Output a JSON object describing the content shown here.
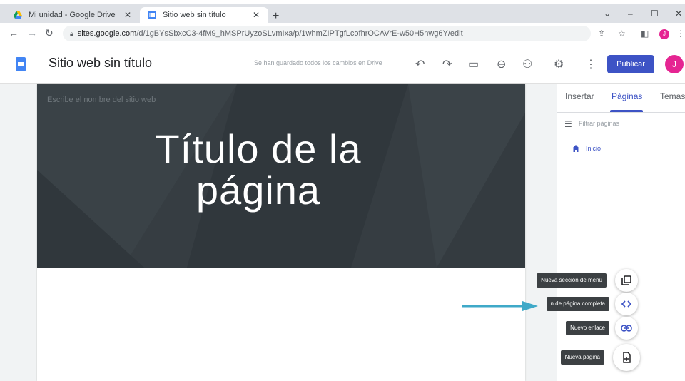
{
  "browser": {
    "tabs": [
      {
        "label": "Mi unidad - Google Drive",
        "active": false
      },
      {
        "label": "Sitio web sin título",
        "active": true
      }
    ],
    "url_host": "sites.google.com",
    "url_path": "/d/1gBYsSbxcC3-4fM9_hMSPrUyzoSLvmIxa/p/1whmZIPTgfLcofhrOCAVrE-w50H5nwg6Y/edit",
    "profile_initial": "J"
  },
  "app": {
    "site_title": "Sitio web sin título",
    "saved_message": "Se han guardado todos los cambios en Drive",
    "publish_label": "Publicar",
    "user_initial": "J",
    "accent_color": "#3d53c5"
  },
  "canvas": {
    "site_name_placeholder": "Escribe el nombre del sitio web",
    "page_title_line1": "Título de la",
    "page_title_line2": "página"
  },
  "right_panel": {
    "tabs": [
      "Insertar",
      "Páginas",
      "Temas"
    ],
    "active_tab": "Páginas",
    "filter_placeholder": "Filtrar páginas",
    "pages": [
      {
        "label": "Inicio",
        "icon": "home-icon"
      }
    ]
  },
  "fab_menu": {
    "items": [
      {
        "tooltip": "Nueva sección de menú",
        "icon": "menu-section-icon"
      },
      {
        "tooltip": "n de página completa",
        "icon": "code-icon"
      },
      {
        "tooltip": "Nuevo enlace",
        "icon": "link-icon"
      },
      {
        "tooltip": "Nueva página",
        "icon": "new-page-icon"
      }
    ]
  }
}
